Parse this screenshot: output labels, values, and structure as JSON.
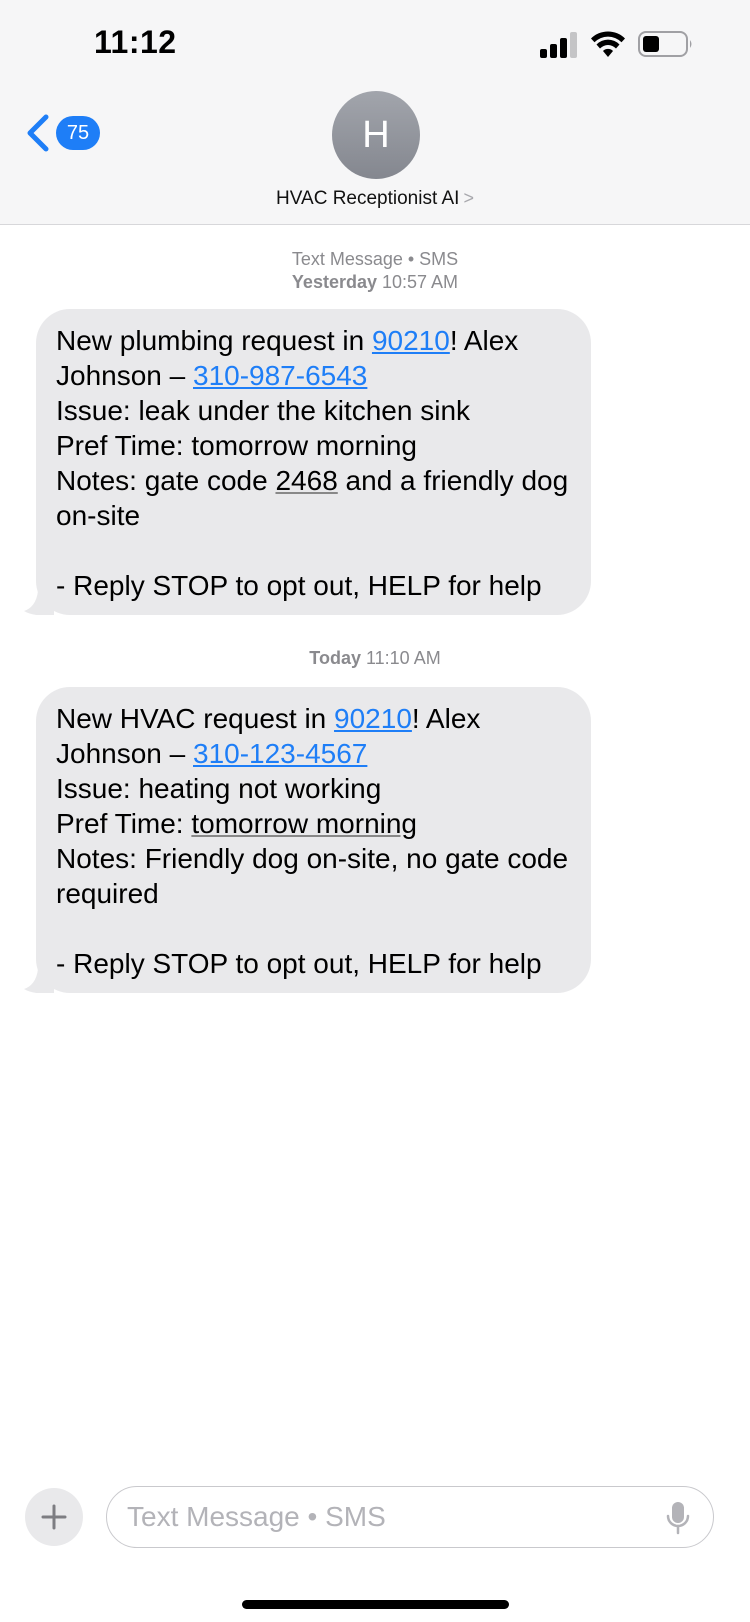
{
  "status_bar": {
    "time": "11:12"
  },
  "header": {
    "back_count": "75",
    "avatar_initial": "H",
    "contact_name": "HVAC Receptionist AI",
    "contact_chevron": ">"
  },
  "conversation": {
    "header_stamp_type": "Text Message • SMS",
    "header_stamp_day": "Yesterday",
    "header_stamp_time": "10:57 AM",
    "messages": [
      {
        "part1": "New plumbing request in ",
        "zip": "90210",
        "part2": "! Alex Johnson – ",
        "phone": "310-987-6543",
        "part3": "\nIssue: leak under the kitchen sink\nPref Time: tomorrow morning\nNotes: gate code ",
        "code": "2468",
        "part4": " and a friendly dog on-site\n\n- Reply STOP to opt out, HELP for help"
      },
      {
        "stamp_day": "Today",
        "stamp_time": "11:10 AM",
        "part1": "New HVAC request in ",
        "zip": "90210",
        "part2": "! Alex Johnson – ",
        "phone": "310-123-4567",
        "part3": "\nIssue: heating not working\nPref Time: ",
        "pref_time": "tomorrow morning",
        "part4": "\nNotes: Friendly dog on-site, no gate code required\n\n- Reply STOP to opt out, HELP for help"
      }
    ]
  },
  "composer": {
    "placeholder": "Text Message • SMS",
    "value": ""
  },
  "colors": {
    "accent": "#1e7ef7",
    "bubble_received": "#e9e9eb",
    "header_bg": "#f6f6f7"
  },
  "icons": [
    "back-chevron-icon",
    "plus-icon",
    "microphone-icon",
    "cellular-signal-icon",
    "wifi-icon",
    "battery-icon"
  ]
}
